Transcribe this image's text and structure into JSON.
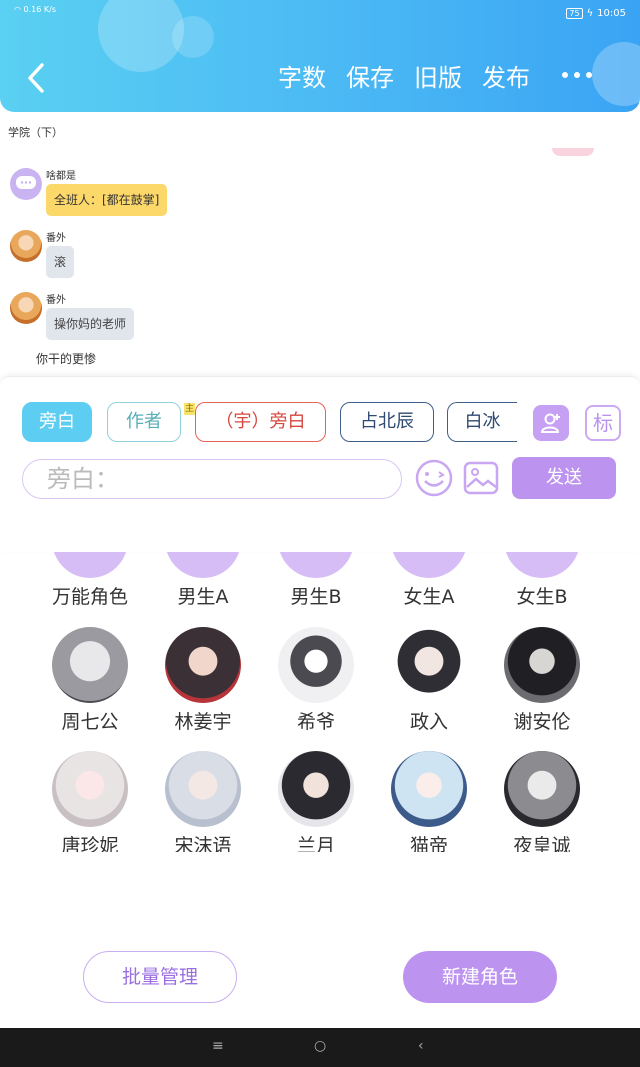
{
  "status_bar": {
    "network_speed": "0.16\nK/s",
    "battery": "75",
    "time": "10:05"
  },
  "header": {
    "word_count_label": "字数",
    "save_label": "保存",
    "old_version_label": "旧版",
    "publish_label": "发布"
  },
  "chapter_title": "学院（下）",
  "messages": [
    {
      "sender": "啥都是",
      "text": "全班人：[都在鼓掌]"
    },
    {
      "sender": "番外",
      "text": "滚"
    },
    {
      "sender": "番外",
      "text": "操你妈的老师"
    }
  ],
  "plain_line": "你干的更惨",
  "role_chips": [
    {
      "label": "旁白",
      "selected": true
    },
    {
      "label": "作者",
      "selected": false
    },
    {
      "label": "（宇）旁白",
      "selected": false
    },
    {
      "label": "占北辰",
      "selected": false
    },
    {
      "label": "白冰",
      "selected": false
    }
  ],
  "main_tag": "主",
  "tag_button_label": "标",
  "input": {
    "placeholder": "旁白："
  },
  "send_label": "发送",
  "characters": [
    {
      "name": "万能角色"
    },
    {
      "name": "男生A"
    },
    {
      "name": "男生B"
    },
    {
      "name": "女生A"
    },
    {
      "name": "女生B"
    },
    {
      "name": "周七公"
    },
    {
      "name": "林姜宇"
    },
    {
      "name": "希爷"
    },
    {
      "name": "政入"
    },
    {
      "name": "谢安伦"
    },
    {
      "name": "唐珍妮"
    },
    {
      "name": "宋沫语"
    },
    {
      "name": "兰月"
    },
    {
      "name": "猫帝"
    },
    {
      "name": "夜皇诚"
    }
  ],
  "batch_manage_label": "批量管理",
  "new_role_label": "新建角色",
  "colors": {
    "accent_purple": "#bd93f0",
    "header_blue": "#4ab8f4",
    "narration_blue": "#5dcdf2"
  }
}
